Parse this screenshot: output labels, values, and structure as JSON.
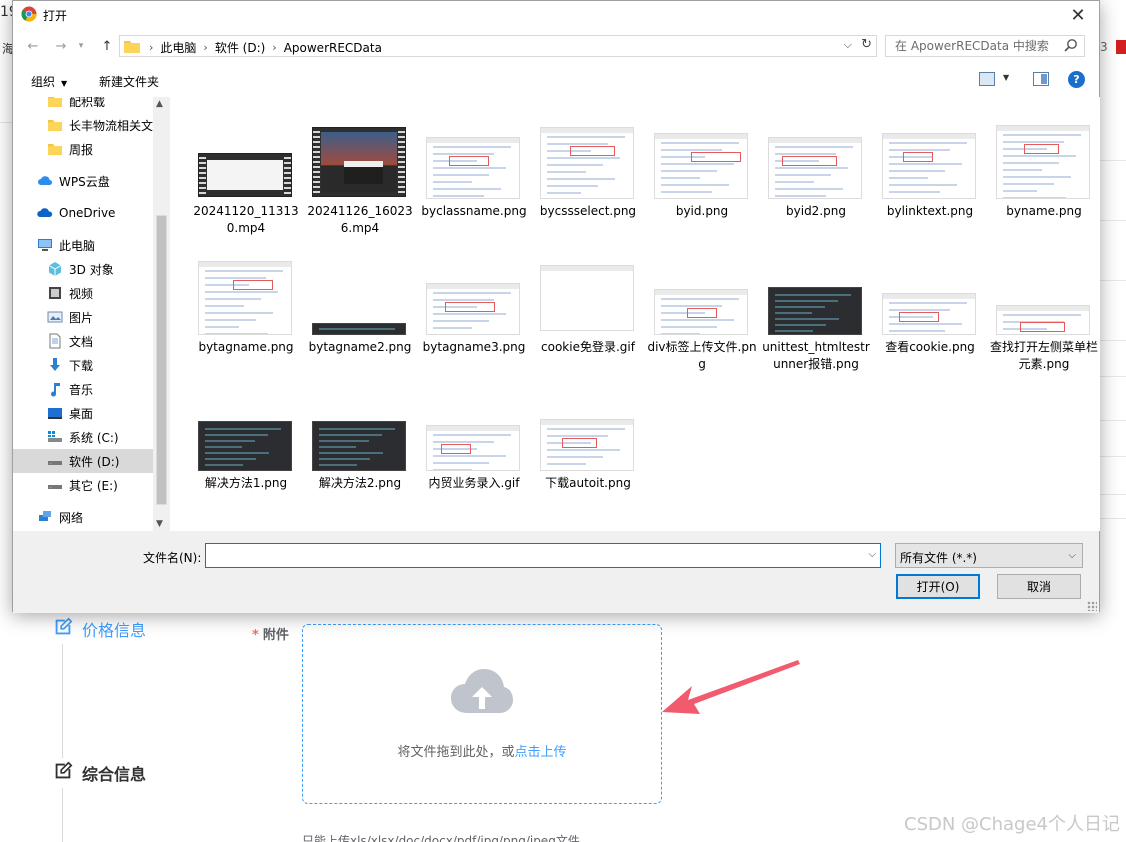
{
  "background": {
    "top_left_fragment": "19",
    "left_fragment": "海",
    "right_fragment": "3",
    "sections": [
      {
        "label": "价格信息"
      },
      {
        "label": "综合信息"
      }
    ],
    "attachment": {
      "required_mark": "*",
      "label": "附件",
      "drop_text": "将文件拖到此处，或",
      "click_text": "点击上传",
      "tip": "只能上传xls/xlsx/doc/docx/pdf/jpg/png/jpeg文件"
    },
    "watermark": "CSDN @Chage4个人日记"
  },
  "dialog": {
    "title": "打开",
    "breadcrumb": [
      "此电脑",
      "软件 (D:)",
      "ApowerRECData"
    ],
    "search_placeholder": "在 ApowerRECData 中搜索",
    "toolbar": {
      "organize": "组织",
      "new_folder": "新建文件夹"
    },
    "nav_items": [
      {
        "label": "配积载",
        "icon": "folder-icon"
      },
      {
        "label": "长丰物流相关文件",
        "icon": "folder-icon"
      },
      {
        "label": "周报",
        "icon": "folder-icon"
      },
      {
        "label": "WPS云盘",
        "icon": "cloud-icon"
      },
      {
        "label": "OneDrive",
        "icon": "onedrive-icon"
      },
      {
        "label": "此电脑",
        "icon": "computer-icon"
      },
      {
        "label": "3D 对象",
        "icon": "cube-icon"
      },
      {
        "label": "视频",
        "icon": "video-icon"
      },
      {
        "label": "图片",
        "icon": "picture-icon"
      },
      {
        "label": "文档",
        "icon": "document-icon"
      },
      {
        "label": "下载",
        "icon": "download-icon"
      },
      {
        "label": "音乐",
        "icon": "music-icon"
      },
      {
        "label": "桌面",
        "icon": "desktop-icon"
      },
      {
        "label": "系统 (C:)",
        "icon": "drive-c-icon"
      },
      {
        "label": "软件 (D:)",
        "icon": "drive-icon"
      },
      {
        "label": "其它 (E:)",
        "icon": "drive-icon"
      },
      {
        "label": "网络",
        "icon": "network-icon"
      }
    ],
    "files": [
      {
        "name": "20241120_113130.mp4",
        "kind": "video"
      },
      {
        "name": "20241126_160236.mp4",
        "kind": "video2"
      },
      {
        "name": "byclassname.png",
        "kind": "shot"
      },
      {
        "name": "bycssselect.png",
        "kind": "shot"
      },
      {
        "name": "byid.png",
        "kind": "shot"
      },
      {
        "name": "byid2.png",
        "kind": "shot"
      },
      {
        "name": "bylinktext.png",
        "kind": "shot"
      },
      {
        "name": "byname.png",
        "kind": "shot"
      },
      {
        "name": "bytagname.png",
        "kind": "shot"
      },
      {
        "name": "bytagname2.png",
        "kind": "strip"
      },
      {
        "name": "bytagname3.png",
        "kind": "shot"
      },
      {
        "name": "cookie免登录.gif",
        "kind": "blank"
      },
      {
        "name": "div标签上传文件.png",
        "kind": "shot"
      },
      {
        "name": "unittest_htmltestrunner报错.png",
        "kind": "dark"
      },
      {
        "name": "查看cookie.png",
        "kind": "shot"
      },
      {
        "name": "查找打开左侧菜单栏元素.png",
        "kind": "shot"
      },
      {
        "name": "解决方法1.png",
        "kind": "dark"
      },
      {
        "name": "解决方法2.png",
        "kind": "dark"
      },
      {
        "name": "内贸业务录入.gif",
        "kind": "shot"
      },
      {
        "name": "下载autoit.png",
        "kind": "shot"
      }
    ],
    "filename_label": "文件名(N):",
    "filename_value": "",
    "filetype": "所有文件 (*.*)",
    "open_button": "打开(O)",
    "cancel_button": "取消"
  },
  "colors": {
    "accent": "#409eff",
    "arrow": "#f25a6e",
    "dialog_focus": "#0078d7"
  }
}
